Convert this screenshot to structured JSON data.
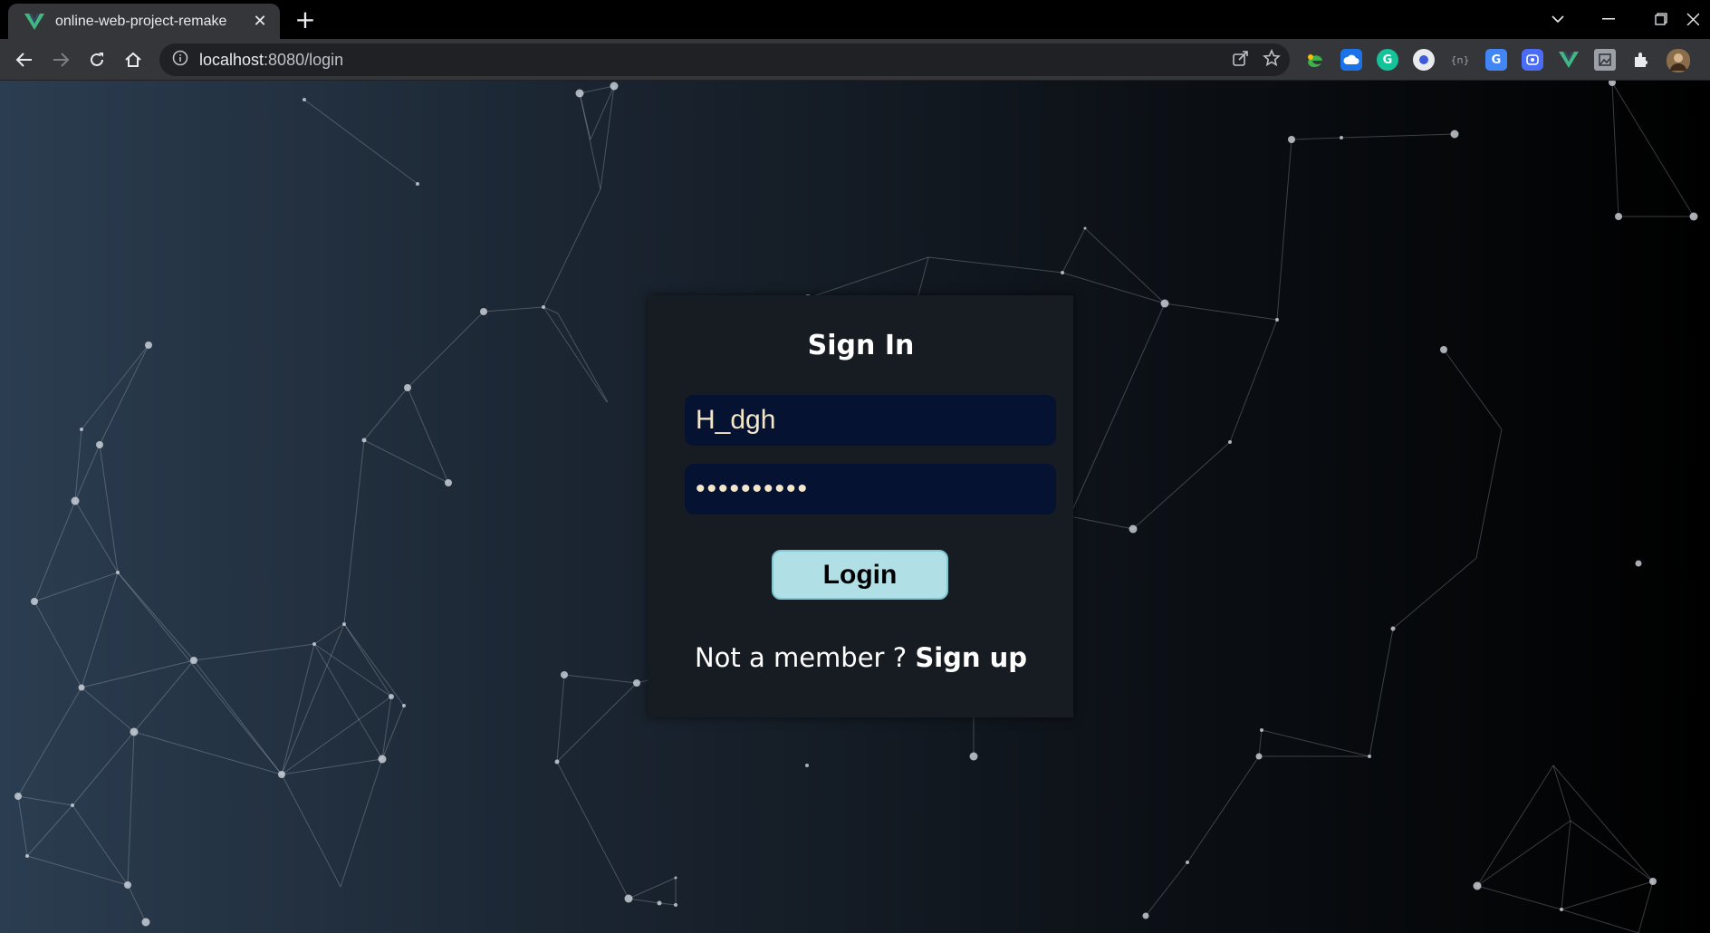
{
  "browser": {
    "tab_title": "online-web-project-remake",
    "url_host": "localhost",
    "url_rest": ":8080/login",
    "extensions": [
      {
        "name": "edge-icon",
        "color": "#2fa84f"
      },
      {
        "name": "cloud-icon",
        "color": "#1a73e8"
      },
      {
        "name": "grammarly-icon",
        "color": "#15c39a"
      },
      {
        "name": "circle-ext-icon",
        "color": "#4a6cf7"
      },
      {
        "name": "bracket-ext-icon",
        "color": "#5f6368"
      },
      {
        "name": "translate-icon",
        "color": "#4285f4"
      },
      {
        "name": "screen-ext-icon",
        "color": "#4a6cf7"
      },
      {
        "name": "vue-devtools-icon",
        "color": "#41b883"
      },
      {
        "name": "image-ext-icon",
        "color": "#9aa0a6"
      },
      {
        "name": "puzzle-icon",
        "color": "#e8eaed"
      },
      {
        "name": "profile-avatar",
        "color": "#8a6d4b"
      }
    ]
  },
  "login": {
    "title": "Sign In",
    "username_value": "H_dgh",
    "password_value": "••••••••••",
    "login_label": "Login",
    "signup_prompt": "Not a member ? ",
    "signup_link": "Sign up"
  },
  "colors": {
    "card_bg": "#171c22",
    "input_bg": "#061232",
    "button_bg": "#b0e0e6"
  }
}
